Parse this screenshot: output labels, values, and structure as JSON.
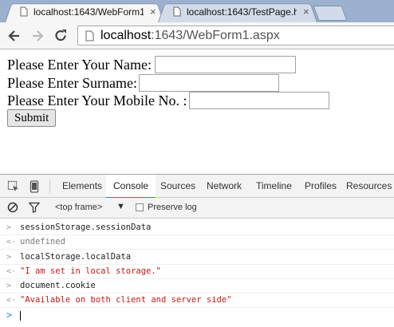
{
  "tabs": [
    {
      "title": "localhost:1643/WebForm1",
      "active": true,
      "close": "×"
    },
    {
      "title": "localhost:1643/TestPage.h",
      "active": false,
      "close": "×"
    }
  ],
  "address": {
    "host": "localhost",
    "path": ":1643/WebForm1.aspx"
  },
  "form": {
    "name_label": "Please Enter Your Name:",
    "surname_label": "Please Enter Surname:",
    "mobile_label": "Please Enter Your Mobile No. :",
    "name_value": "",
    "surname_value": "",
    "mobile_value": "",
    "submit_label": "Submit"
  },
  "devtools": {
    "tabs": [
      "Elements",
      "Console",
      "Sources",
      "Network",
      "Timeline",
      "Profiles",
      "Resources"
    ],
    "active_tab": "Console",
    "frame_select": "<top frame>",
    "preserve_log": "Preserve log"
  },
  "console": {
    "lines": [
      {
        "kind": "input",
        "glyph": ">",
        "text": "sessionStorage.sessionData"
      },
      {
        "kind": "result",
        "glyph": "<·",
        "text": "undefined"
      },
      {
        "kind": "input",
        "glyph": ">",
        "text": "localStorage.localData"
      },
      {
        "kind": "result",
        "glyph": "<·",
        "text": "\"I am set in local storage.\""
      },
      {
        "kind": "input",
        "glyph": ">",
        "text": "document.cookie"
      },
      {
        "kind": "result",
        "glyph": "<·",
        "text": "\"Available on both client and server side\""
      }
    ],
    "prompt": ">"
  },
  "colors": {
    "accent": "#3879d9",
    "string": "#c41a16",
    "tabstrip": "#9cb1cf"
  }
}
